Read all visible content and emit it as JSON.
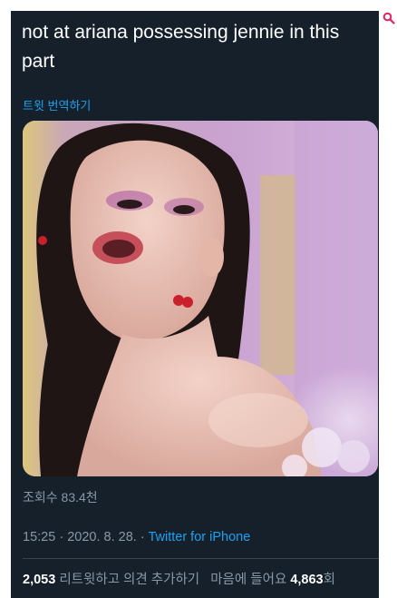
{
  "tweet": {
    "text": "not at ariana possessing jennie in this part",
    "translate_label": "트윗 번역하기",
    "views": "조회수 83.4천",
    "time": "15:25",
    "date": "2020. 8. 28.",
    "dot": "·",
    "source": "Twitter for iPhone"
  },
  "stats": {
    "retweets_count": "2,053",
    "retweets_label": "리트윗하고 의견 추가하기",
    "likes_label": "마음에 들어요",
    "likes_count": "4,863",
    "likes_suffix": "회"
  },
  "icons": {
    "corner": "search-icon"
  },
  "colors": {
    "background": "#15202b",
    "accent": "#1da1f2",
    "muted": "#8899a6",
    "corner_icon": "#e0245e"
  }
}
